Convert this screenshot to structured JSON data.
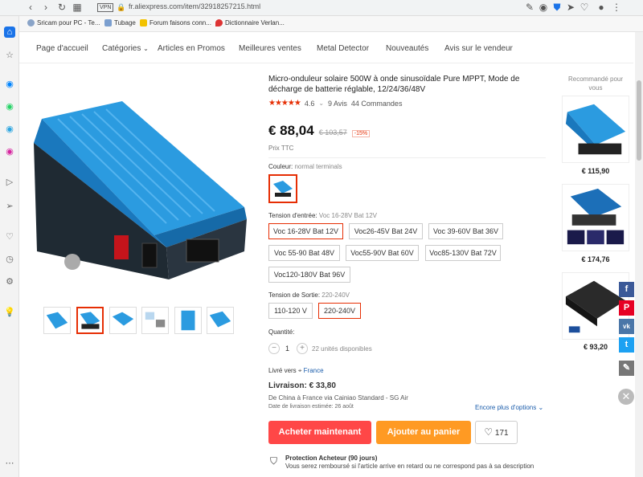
{
  "browser": {
    "url": "fr.aliexpress.com/item/32918257215.html",
    "vpn": "VPN"
  },
  "bookmarks": [
    {
      "label": "Sricam pour PC - Te..."
    },
    {
      "label": "Tubage"
    },
    {
      "label": "Forum faisons conn..."
    },
    {
      "label": "Dictionnaire Verlan..."
    }
  ],
  "nav": {
    "items": [
      "Page d'accueil",
      "Catégories",
      "Articles en Promos",
      "Meilleures ventes",
      "Metal Detector",
      "Nouveautés",
      "Avis sur le vendeur"
    ]
  },
  "product": {
    "title": "Micro-onduleur solaire 500W à onde sinusoïdale Pure MPPT, Mode de décharge de batterie réglable, 12/24/36/48V",
    "rating_stars": "★★★★★",
    "rating": "4.6",
    "reviews": "9 Avis",
    "orders": "44 Commandes",
    "price": "€ 88,04",
    "old_price": "€ 103,57",
    "discount": "-15%",
    "tax_note": "Prix TTC"
  },
  "color": {
    "label": "Couleur:",
    "value": "normal terminals"
  },
  "voltage_in": {
    "label": "Tension d'entrée:",
    "value": "Voc 16-28V Bat 12V",
    "options": [
      "Voc 16-28V Bat 12V",
      "Voc26-45V Bat 24V",
      "Voc 39-60V Bat 36V",
      "Voc 55-90 Bat 48V",
      "Voc55-90V Bat 60V",
      "Voc85-130V Bat 72V",
      "Voc120-180V Bat 96V"
    ]
  },
  "voltage_out": {
    "label": "Tension de Sortie:",
    "value": "220-240V",
    "options": [
      "110-120 V",
      "220-240V"
    ]
  },
  "quantity": {
    "label": "Quantité:",
    "minus": "−",
    "value": "1",
    "plus": "+",
    "available": "22 unités disponibles"
  },
  "shipping": {
    "to_label": "Livré vers",
    "country": "France",
    "price": "Livraison: € 33,80",
    "via": "De China à France via Cainiao Standard - SG Air",
    "date": "Date de livraison estimée: 26 août",
    "more": "Encore plus d'options"
  },
  "actions": {
    "buy": "Acheter maintenant",
    "cart": "Ajouter au panier",
    "wish_count": "171"
  },
  "protection": {
    "title": "Protection Acheteur (90 jours)",
    "desc": "Vous serez remboursé si l'article arrive en retard ou ne correspond pas à sa description"
  },
  "recommended": {
    "title": "Recommandé pour vous",
    "items": [
      {
        "price": "€ 115,90"
      },
      {
        "price": "€ 174,76"
      },
      {
        "price": "€ 93,20"
      }
    ]
  },
  "colors": {
    "accent": "#e62e04",
    "buy": "#ff4747",
    "cart": "#ff9a23",
    "product_blue": "#1e8fd6"
  }
}
